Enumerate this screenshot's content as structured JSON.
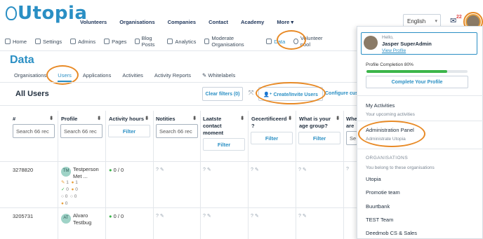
{
  "app": {
    "logo": "Utopia"
  },
  "topnav": [
    "Volunteers",
    "Organisations",
    "Companies",
    "Contact",
    "Academy",
    "More"
  ],
  "header": {
    "language": "English",
    "notif_count": "22"
  },
  "subnav": [
    "Home",
    "Settings",
    "Admins",
    "Pages",
    "Blog Posts",
    "Analytics",
    "Moderate Organisations",
    "Data",
    "Volunteer pool"
  ],
  "page": {
    "title": "Data"
  },
  "tabs": [
    "Organisations",
    "Users",
    "Applications",
    "Activities",
    "Activity Reports",
    "Whitelabels"
  ],
  "list": {
    "title": "All Users",
    "clear_filters": "Clear filters (0)",
    "create_invite": "Create/Invite Users",
    "configure": "Configure cust"
  },
  "columns": [
    "#",
    "Profile",
    "Activity hours",
    "Notities",
    "Laatste contact moment",
    "Gecertificeerd ?",
    "What is your age group?",
    "Whe are"
  ],
  "search_placeholder": "Search 66 rec",
  "filter_label": "Filter",
  "rows": [
    {
      "id": "3278820",
      "initials": "TM",
      "name": "Testperson Met ...",
      "hours": "0 / 0",
      "counts": [
        "1",
        "1",
        "0",
        "0",
        "0",
        "0",
        "0"
      ]
    },
    {
      "id": "3205731",
      "initials": "AT",
      "name": "Alvaro Testbug",
      "hours": "0 / 0"
    }
  ],
  "user_menu": {
    "hello": "Hello,",
    "name": "Jasper SuperAdmin",
    "view_profile": "View Profile",
    "completion": "Profile Completion 80%",
    "completion_value": 0.8,
    "complete_btn": "Complete Your Profile",
    "my_activities": "My Activities",
    "upcoming": "Your upcoming activities",
    "admin_panel": "Administration Panel",
    "admin_sub": "Administrate Utopia",
    "orgs_header": "ORGANISATIONS",
    "orgs_sub": "You belong to these organisations",
    "orgs": [
      "Utopia",
      "Promotie team",
      "Buurtbank",
      "TEST Team",
      "Deedmob CS & Sales"
    ]
  },
  "colors": {
    "accent": "#2a8fc4",
    "highlight": "#e88a26",
    "progress": "#3bb54a"
  }
}
